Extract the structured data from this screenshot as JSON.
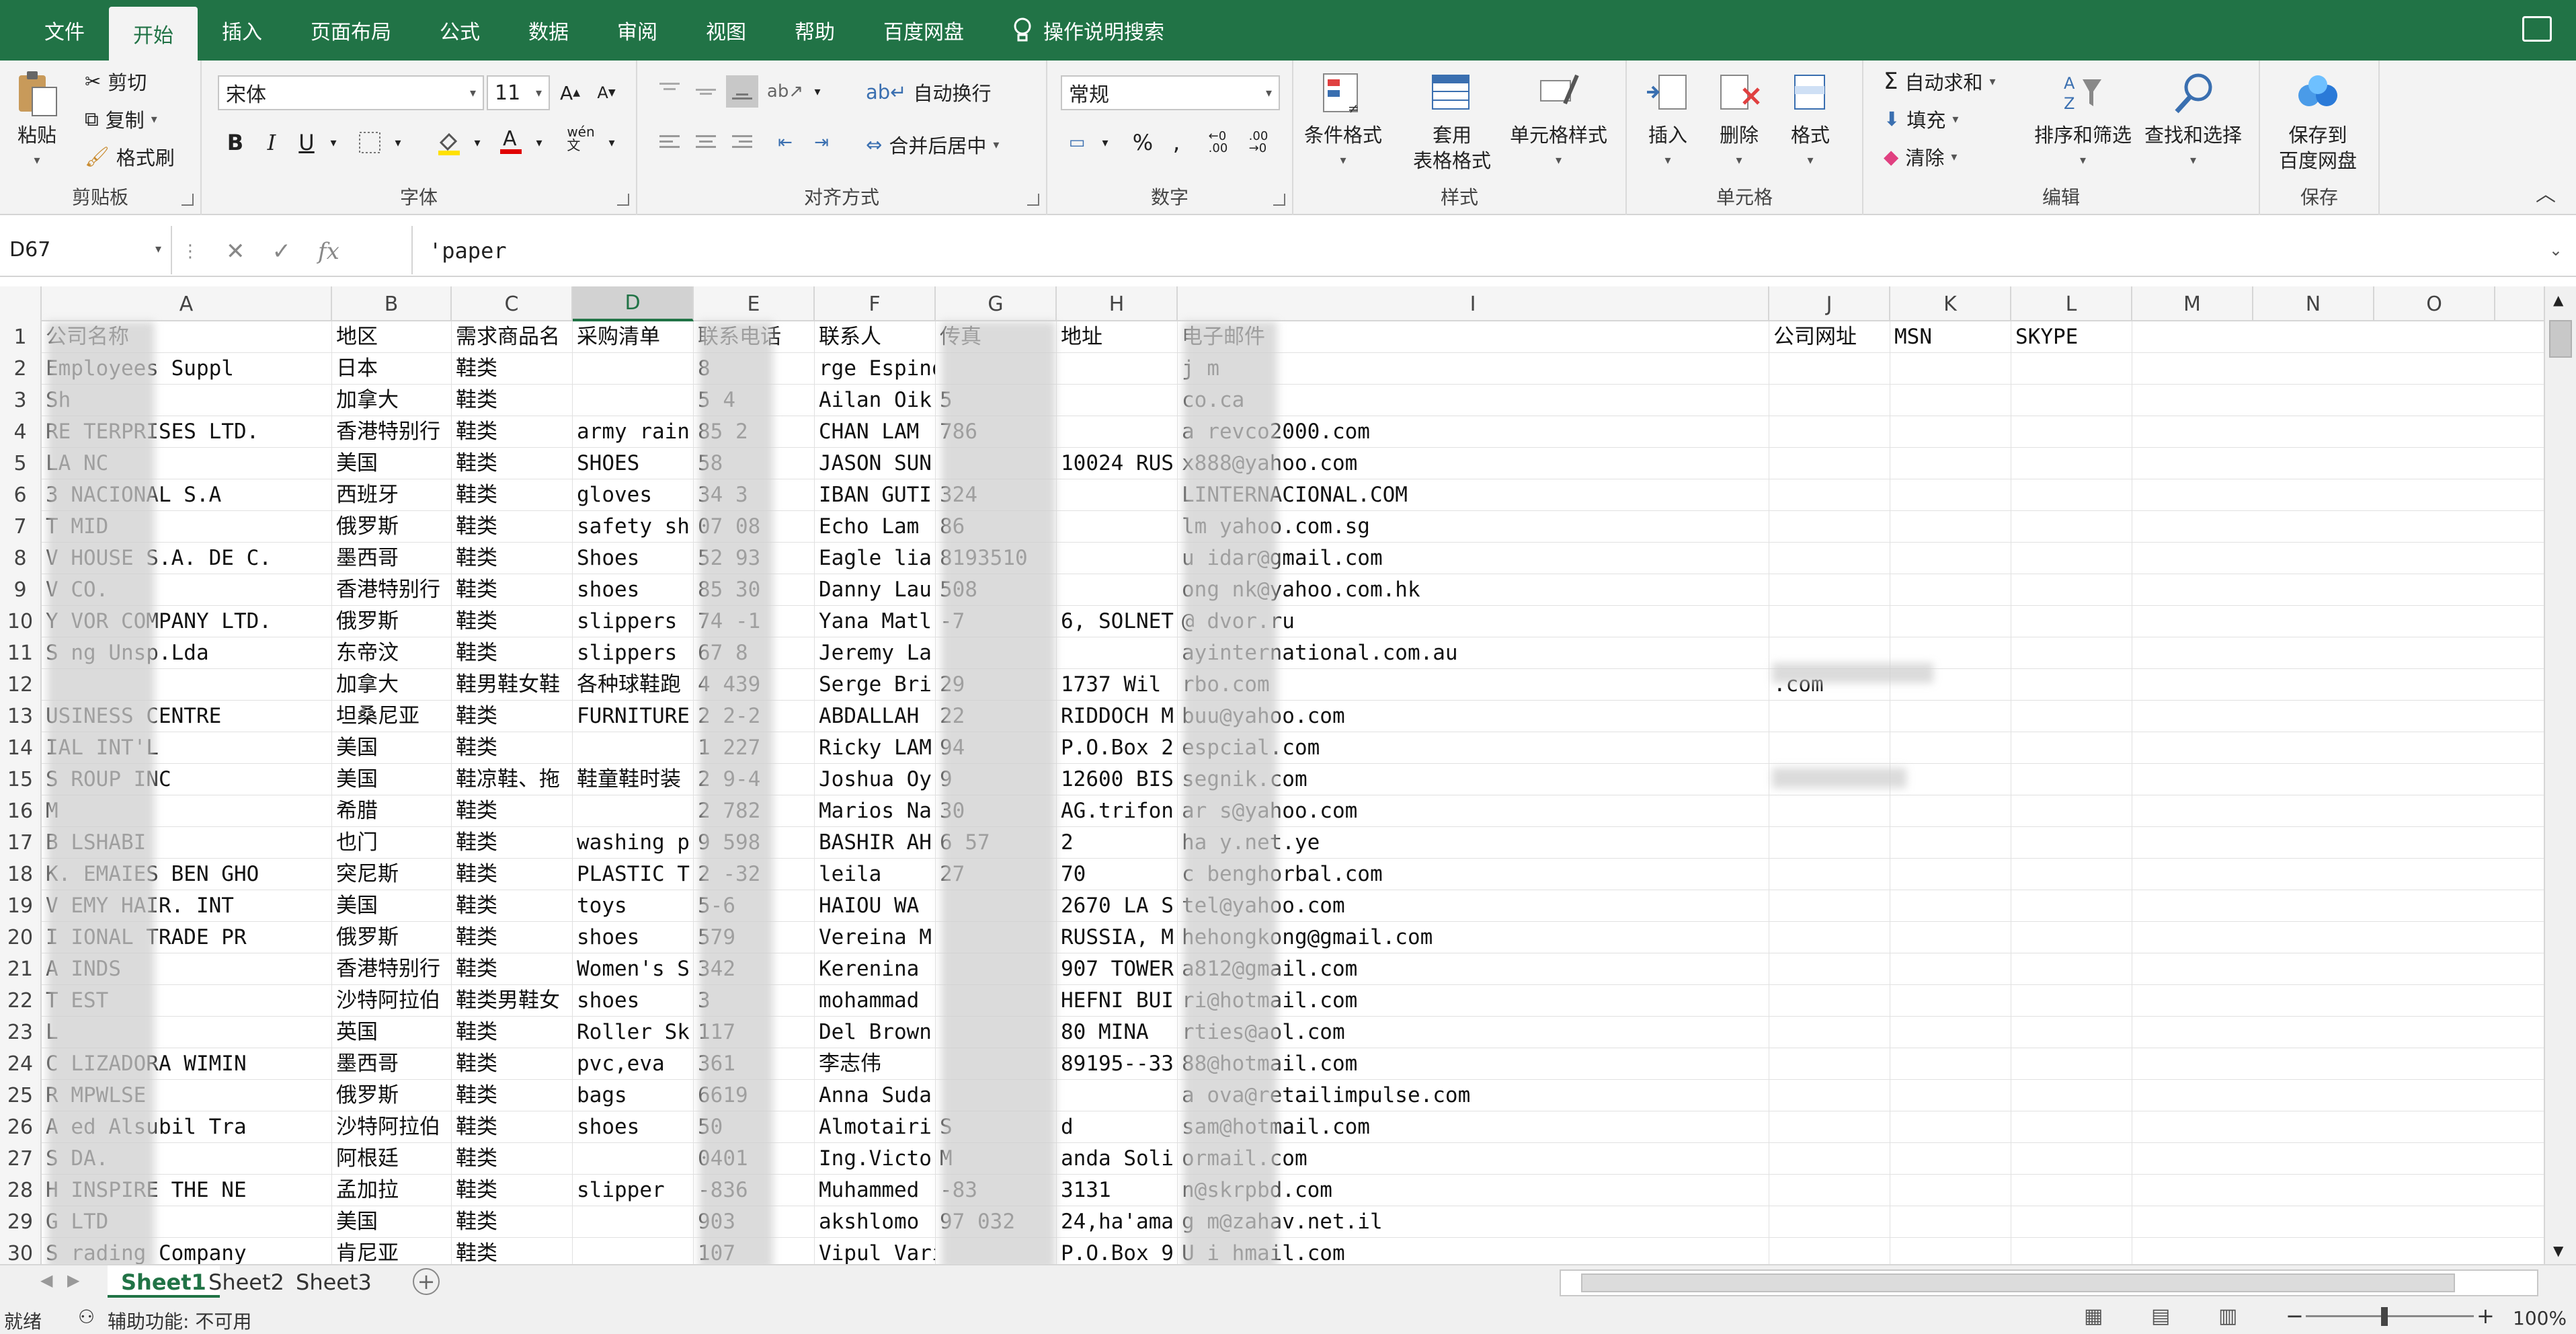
{
  "menu": [
    "文件",
    "开始",
    "插入",
    "页面布局",
    "公式",
    "数据",
    "审阅",
    "视图",
    "帮助",
    "百度网盘"
  ],
  "menu_active": "开始",
  "tell_me": "操作说明搜索",
  "ribbon": {
    "clipboard": {
      "paste": "粘贴",
      "cut": "剪切",
      "copy": "复制",
      "format_painter": "格式刷",
      "label": "剪贴板"
    },
    "font": {
      "name": "宋体",
      "size": "11",
      "label": "字体"
    },
    "alignment": {
      "wrap": "自动换行",
      "merge": "合并后居中",
      "label": "对齐方式"
    },
    "number": {
      "format": "常规",
      "label": "数字"
    },
    "styles": {
      "conditional": "条件格式",
      "table1": "套用",
      "table2": "表格格式",
      "cell_styles": "单元格样式",
      "label": "样式"
    },
    "cells": {
      "insert": "插入",
      "delete": "删除",
      "format": "格式",
      "label": "单元格"
    },
    "editing": {
      "autosum": "自动求和",
      "fill": "填充",
      "clear": "清除",
      "sort": "排序和筛选",
      "find": "查找和选择",
      "label": "编辑"
    },
    "save": {
      "line1": "保存到",
      "line2": "百度网盘",
      "label": "保存"
    }
  },
  "formula_bar": {
    "name_box": "D67",
    "content": "'paper"
  },
  "columns": [
    "A",
    "B",
    "C",
    "D",
    "E",
    "F",
    "G",
    "H",
    "I",
    "J",
    "K",
    "L",
    "M",
    "N",
    "O"
  ],
  "selected_column": "D",
  "rows": [
    {
      "n": "1",
      "a": "公司名称",
      "b": "地区",
      "c": "需求商品名",
      "d": "采购清单",
      "e": "联系电话",
      "f": "联系人",
      "g": "传真",
      "h": "地址",
      "i": "电子邮件",
      "j": "公司网址",
      "k": "MSN",
      "l": "SKYPE"
    },
    {
      "n": "2",
      "a": "      Employees Suppl",
      "b": "日本",
      "c": "鞋类",
      "d": "",
      "e": "8",
      "f": "rge Espinosa Cepeda",
      "g": "",
      "h": "",
      "i": "j                         m"
    },
    {
      "n": "3",
      "a": "Sh",
      "b": "加拿大",
      "c": "鞋类",
      "d": "",
      "e": "5          4",
      "f": "Ailan Oik",
      "g": "5",
      "h": "",
      "i": "                     co.ca"
    },
    {
      "n": "4",
      "a": "RE    TERPRISES LTD.",
      "b": "香港特别行",
      "c": "鞋类",
      "d": "army rain",
      "e": "85         2",
      "f": "CHAN LAM",
      "g": "      786",
      "h": "",
      "i": "a      revco2000.com"
    },
    {
      "n": "5",
      "a": "LA      NC",
      "b": "美国",
      "c": "鞋类",
      "d": "SHOES",
      "e": "58",
      "f": "JASON SUN",
      "g": "",
      "h": "10024 RUS",
      "i": "     x888@yahoo.com"
    },
    {
      "n": "6",
      "a": "3      NACIONAL S.A",
      "b": "西班牙",
      "c": "鞋类",
      "d": "gloves",
      "e": "34        3",
      "f": "IBAN GUTI",
      "g": "     324",
      "h": "",
      "i": "     LINTERNACIONAL.COM"
    },
    {
      "n": "7",
      "a": "T      MID",
      "b": "俄罗斯",
      "c": "鞋类",
      "d": "safety sh",
      "e": "07        08",
      "f": "Echo Lam",
      "g": "     86",
      "h": "",
      "i": "     lm  yahoo.com.sg"
    },
    {
      "n": "8",
      "a": "V     HOUSE S.A. DE C.",
      "b": "墨西哥",
      "c": "鞋类",
      "d": "Shoes",
      "e": "52        93",
      "f": "Eagle lia",
      "g": "      8193510",
      "h": "",
      "i": "     u  idar@gmail.com"
    },
    {
      "n": "9",
      "a": "V      CO.",
      "b": "香港特别行",
      "c": "鞋类",
      "d": "shoes",
      "e": "85        30",
      "f": "Danny Lau",
      "g": "      508",
      "h": "",
      "i": "     ong  nk@yahoo.com.hk"
    },
    {
      "n": "10",
      "a": "Y     VOR COMPANY LTD.",
      "b": "俄罗斯",
      "c": "鞋类",
      "d": "slippers",
      "e": "74       -1",
      "f": "Yana Matl",
      "g": "      -7",
      "h": "6, SOLNET",
      "i": "     @  dvor.ru"
    },
    {
      "n": "11",
      "a": "S     ng Unsp.Lda",
      "b": "东帝汶",
      "c": "鞋类",
      "d": "slippers",
      "e": "67       8",
      "f": "Jeremy La",
      "g": "",
      "h": "",
      "i": "     ayinternational.com.au"
    },
    {
      "n": "12",
      "a": "",
      "b": "加拿大",
      "c": "鞋男鞋女鞋",
      "d": "各种球鞋跑",
      "e": "4        439",
      "f": "Serge Bri",
      "g": "      29",
      "h": "1737 Wil",
      "i": "     rbo.com",
      "j": "          .com"
    },
    {
      "n": "13",
      "a": "      USINESS CENTRE",
      "b": "坦桑尼亚",
      "c": "鞋类",
      "d": "FURNITURE",
      "e": "2        2-2",
      "f": "ABDALLAH",
      "g": "     22",
      "h": "RIDDOCH M",
      "i": "     buu@yahoo.com"
    },
    {
      "n": "14",
      "a": "      IAL INT'L",
      "b": "美国",
      "c": "鞋类",
      "d": "",
      "e": "1        227",
      "f": "Ricky LAM",
      "g": "      94",
      "h": "P.O.Box 2",
      "i": "     espcial.com"
    },
    {
      "n": "15",
      "a": "S     ROUP INC",
      "b": "美国",
      "c": "鞋凉鞋、拖",
      "d": "鞋童鞋时装",
      "e": "2        9-4",
      "f": "Joshua Oy",
      "g": "      9",
      "h": "12600 BIS",
      "i": "     segnik.com"
    },
    {
      "n": "16",
      "a": "M",
      "b": "希腊",
      "c": "鞋类",
      "d": "",
      "e": "2        782",
      "f": "Marios Na",
      "g": "      30",
      "h": "AG.trifon",
      "i": "     ar  s@yahoo.com",
      "j": "       "
    },
    {
      "n": "17",
      "a": "B     LSHABI",
      "b": "也门",
      "c": "鞋类",
      "d": "washing p",
      "e": "9        598",
      "f": "BASHIR AH",
      "g": "     6  57",
      "h": "2",
      "i": "     ha    y.net.ye"
    },
    {
      "n": "18",
      "a": "K.    EMAIES BEN GHO",
      "b": "突尼斯",
      "c": "鞋类",
      "d": "PLASTIC T",
      "e": "2        -32",
      "f": "leila",
      "g": "     27",
      "h": "70",
      "i": "     c   benghorbal.com"
    },
    {
      "n": "19",
      "a": "V     EMY HAIR. INT",
      "b": "美国",
      "c": "鞋类",
      "d": "toys",
      "e": "         5-6",
      "f": "HAIOU WA",
      "g": "",
      "h": "2670 LA S",
      "i": "     tel@yahoo.com"
    },
    {
      "n": "20",
      "a": "I     IONAL TRADE PR",
      "b": "俄罗斯",
      "c": "鞋类",
      "d": "shoes",
      "e": "         579",
      "f": "Vereina M",
      "g": "",
      "h": "RUSSIA, M",
      "i": "     hehongkong@gmail.com"
    },
    {
      "n": "21",
      "a": "A     INDS",
      "b": "香港特别行",
      "c": "鞋类",
      "d": "Women's S",
      "e": "         342",
      "f": "Kerenina",
      "g": "",
      "h": "907 TOWER",
      "i": "     a812@gmail.com"
    },
    {
      "n": "22",
      "a": "T     EST",
      "b": "沙特阿拉伯",
      "c": "鞋类男鞋女",
      "d": "shoes",
      "e": "        3",
      "f": "mohammad",
      "g": "",
      "h": "HEFNI BUI",
      "i": "     ri@hotmail.com"
    },
    {
      "n": "23",
      "a": "L",
      "b": "英国",
      "c": "鞋类",
      "d": "Roller Sk",
      "e": "        117",
      "f": "Del Brown",
      "g": "",
      "h": "80  MINA",
      "i": "     rties@aol.com"
    },
    {
      "n": "24",
      "a": "C     LIZADORA WIMIN",
      "b": "墨西哥",
      "c": "鞋类",
      "d": "pvc,eva",
      "e": "        361",
      "f": "李志伟",
      "g": "",
      "h": "89195--33",
      "i": "     88@hotmail.com"
    },
    {
      "n": "25",
      "a": "R     MPWLSE",
      "b": "俄罗斯",
      "c": "鞋类",
      "d": "bags",
      "e": "        6619",
      "f": "Anna Suda",
      "g": "",
      "h": "",
      "i": "a     ova@retailimpulse.com"
    },
    {
      "n": "26",
      "a": "A     ed Alsubil Tra",
      "b": "沙特阿拉伯",
      "c": "鞋类",
      "d": "shoes",
      "e": "        50",
      "f": "Almotairi",
      "g": "     S",
      "h": "d",
      "i": "     sam@hotmail.com"
    },
    {
      "n": "27",
      "a": "S     DA.",
      "b": "阿根廷",
      "c": "鞋类",
      "d": "",
      "e": "        0401",
      "f": "Ing.Victo",
      "g": "     M",
      "h": "anda Soli",
      "i": "     ormail.com"
    },
    {
      "n": "28",
      "a": "H     INSPIRE THE NE",
      "b": "孟加拉",
      "c": "鞋类",
      "d": "slipper",
      "e": "        -836",
      "f": "Muhammed",
      "g": "     -83",
      "h": "3131",
      "i": "     n@skrpbd.com"
    },
    {
      "n": "29",
      "a": "G     LTD",
      "b": "美国",
      "c": "鞋类",
      "d": "",
      "e": "        903",
      "f": "akshlomo",
      "g": "97   032",
      "h": "24,ha'ama",
      "i": "g     m@zahav.net.il"
    },
    {
      "n": "30",
      "a": "S     rading Company",
      "b": "肯尼亚",
      "c": "鞋类",
      "d": "",
      "e": "        107",
      "f": "Vipul Varia",
      "g": "",
      "h": "P.O.Box 9",
      "i": "U     i  hmail.com"
    }
  ],
  "sheets": [
    "Sheet1",
    "Sheet2",
    "Sheet3"
  ],
  "active_sheet": "Sheet1",
  "status": {
    "ready": "就绪",
    "accessibility": "辅助功能: 不可用",
    "zoom": "100%"
  },
  "accent_color": "#217346"
}
